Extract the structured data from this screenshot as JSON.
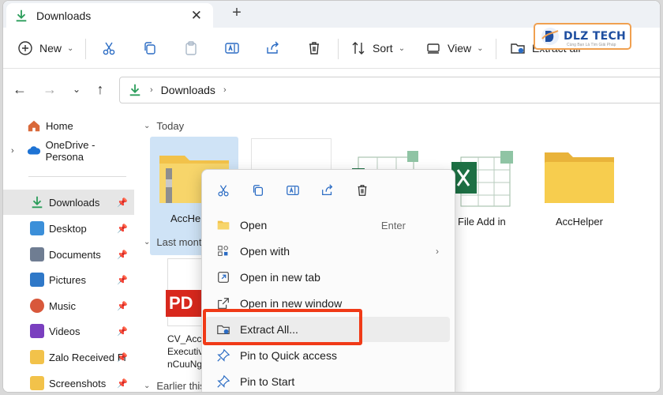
{
  "tab": {
    "title": "Downloads",
    "close": "✕",
    "new_tab": "+"
  },
  "toolbar": {
    "new_label": "New",
    "sort_label": "Sort",
    "view_label": "View",
    "extract_label": "Extract all",
    "more": "···"
  },
  "logo": {
    "brand": "DLZ TECH",
    "tagline": "Cùng Bạn Là Tìm Giải Pháp"
  },
  "address": {
    "location": "Downloads"
  },
  "sidebar": {
    "items": [
      {
        "label": "Home",
        "icon": "home-icon",
        "color": "#d9693a"
      },
      {
        "label": "OneDrive - Persona",
        "icon": "cloud-icon",
        "color": "#1e73d4"
      },
      {
        "label": "Downloads",
        "icon": "download-icon",
        "color": "#2a9d5a"
      },
      {
        "label": "Desktop",
        "icon": "desktop-icon",
        "color": "#3b8fd9"
      },
      {
        "label": "Documents",
        "icon": "document-icon",
        "color": "#6f7d92"
      },
      {
        "label": "Pictures",
        "icon": "picture-icon",
        "color": "#2f78c8"
      },
      {
        "label": "Music",
        "icon": "music-icon",
        "color": "#d8583b"
      },
      {
        "label": "Videos",
        "icon": "video-icon",
        "color": "#7a3fbf"
      },
      {
        "label": "Zalo Received Fi",
        "icon": "folder-icon",
        "color": "#f2c24a"
      },
      {
        "label": "Screenshots",
        "icon": "folder-icon",
        "color": "#f2c24a"
      }
    ]
  },
  "main": {
    "groups": [
      {
        "label": "Today"
      },
      {
        "label": "Last month"
      },
      {
        "label": "Earlier this"
      }
    ],
    "files": [
      {
        "name": "AccHe"
      },
      {
        "name": "File Add in"
      },
      {
        "name": "AccHelper"
      },
      {
        "name_line1": "CV_Acc",
        "name_line2": "Executive_",
        "name_line3": "nCuuNga"
      },
      {
        "pdf_label": "PD"
      }
    ]
  },
  "context_menu": {
    "items": [
      {
        "label": "Open",
        "shortcut": "Enter"
      },
      {
        "label": "Open with",
        "submenu": "›"
      },
      {
        "label": "Open in new tab"
      },
      {
        "label": "Open in new window"
      },
      {
        "label": "Extract All..."
      },
      {
        "label": "Pin to Quick access"
      },
      {
        "label": "Pin to Start"
      }
    ]
  },
  "colors": {
    "highlight": "#f03a17",
    "accent": "#0067c0",
    "folder": "#f2c24a"
  }
}
